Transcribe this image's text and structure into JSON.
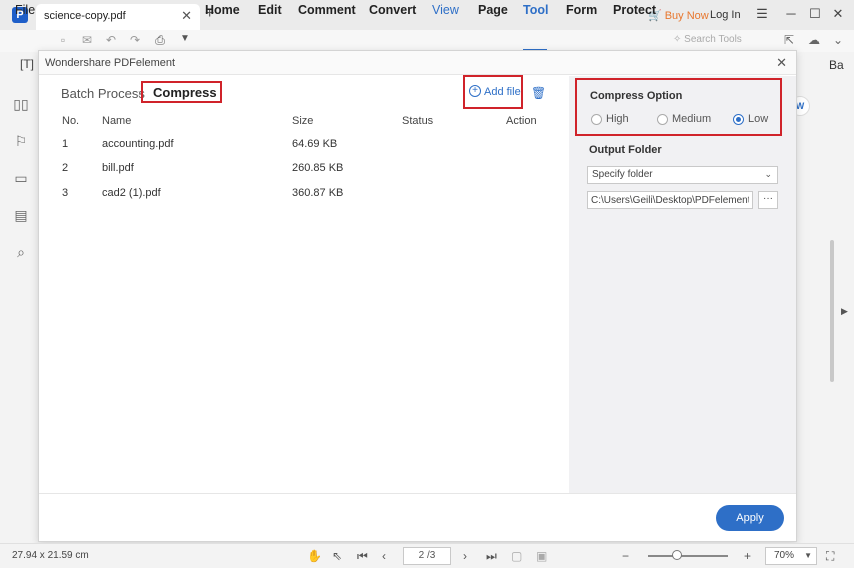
{
  "titlebar": {
    "tab_label": "science-copy.pdf",
    "buy_now": "Buy Now",
    "login": "Log In"
  },
  "menu": {
    "file": "File",
    "items": [
      "Home",
      "Edit",
      "Comment",
      "Convert",
      "View",
      "Page",
      "Tool",
      "Form",
      "Protect"
    ],
    "search_placeholder": "Search Tools"
  },
  "right_edge": {
    "fragment": "Ba"
  },
  "dialog": {
    "title": "Wondershare PDFelement",
    "breadcrumb": {
      "parent": "Batch Process",
      "current": "Compress"
    },
    "add_file": "Add file",
    "table": {
      "headers": [
        "No.",
        "Name",
        "Size",
        "Status",
        "Action"
      ],
      "rows": [
        {
          "no": "1",
          "name": "accounting.pdf",
          "size": "64.69 KB"
        },
        {
          "no": "2",
          "name": "bill.pdf",
          "size": "260.85 KB"
        },
        {
          "no": "3",
          "name": "cad2 (1).pdf",
          "size": "360.87 KB"
        }
      ]
    },
    "compress_option": {
      "title": "Compress Option",
      "options": [
        "High",
        "Medium",
        "Low"
      ],
      "selected": "Low"
    },
    "output_folder": {
      "title": "Output Folder",
      "select_value": "Specify folder",
      "path": "C:\\Users\\Geili\\Desktop\\PDFelement\\Op",
      "browse": "···"
    },
    "apply": "Apply"
  },
  "status": {
    "dimensions": "27.94 x 21.59 cm",
    "page": "2 /3",
    "zoom": "70%",
    "zoom_level": 0.35
  },
  "colors": {
    "accent": "#2e6fc7",
    "highlight": "#d0232a",
    "buy": "#e8772e"
  }
}
